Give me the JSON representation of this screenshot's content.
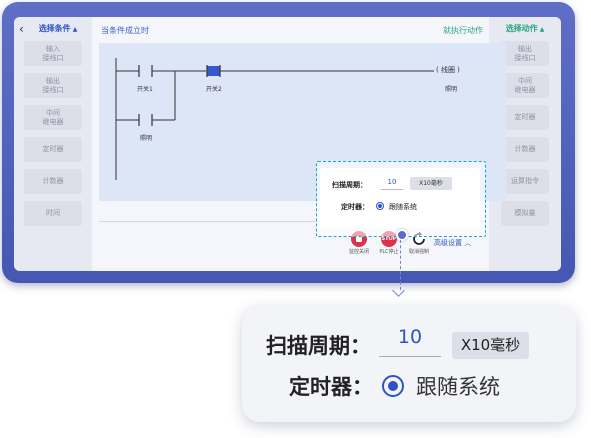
{
  "left_panel": {
    "title": "选择条件",
    "items": [
      "输入\n接线口",
      "输出\n接线口",
      "中间\n继电器",
      "定时器",
      "计数器",
      "时间"
    ]
  },
  "right_panel": {
    "title": "选择动作",
    "items": [
      "输出\n接线口",
      "中间\n继电器",
      "定时器",
      "计数器",
      "运算指令",
      "模拟量"
    ]
  },
  "center": {
    "condition_header": "当条件成立时",
    "action_header": "就执行动作"
  },
  "ladder": {
    "contact1_label": "开关1",
    "contact2_label": "开关2",
    "coil_text": "( 线圈 )",
    "coil_label": "照明",
    "branch_label": "照明"
  },
  "toolbar": {
    "buttons": [
      {
        "label": "监控关闭"
      },
      {
        "label": "PLC停止",
        "icon_text": "STOP"
      },
      {
        "label": "取消强制"
      }
    ],
    "advanced": "高级设置"
  },
  "settings": {
    "scan_label": "扫描周期：",
    "scan_value": "10",
    "scan_unit": "X10毫秒",
    "timer_label": "定时器：",
    "timer_option": "跟随系统"
  },
  "zoom": {
    "scan_label": "扫描周期：",
    "scan_value": "10",
    "scan_unit": "X10毫秒",
    "timer_label": "定时器：",
    "timer_option": "跟随系统"
  }
}
